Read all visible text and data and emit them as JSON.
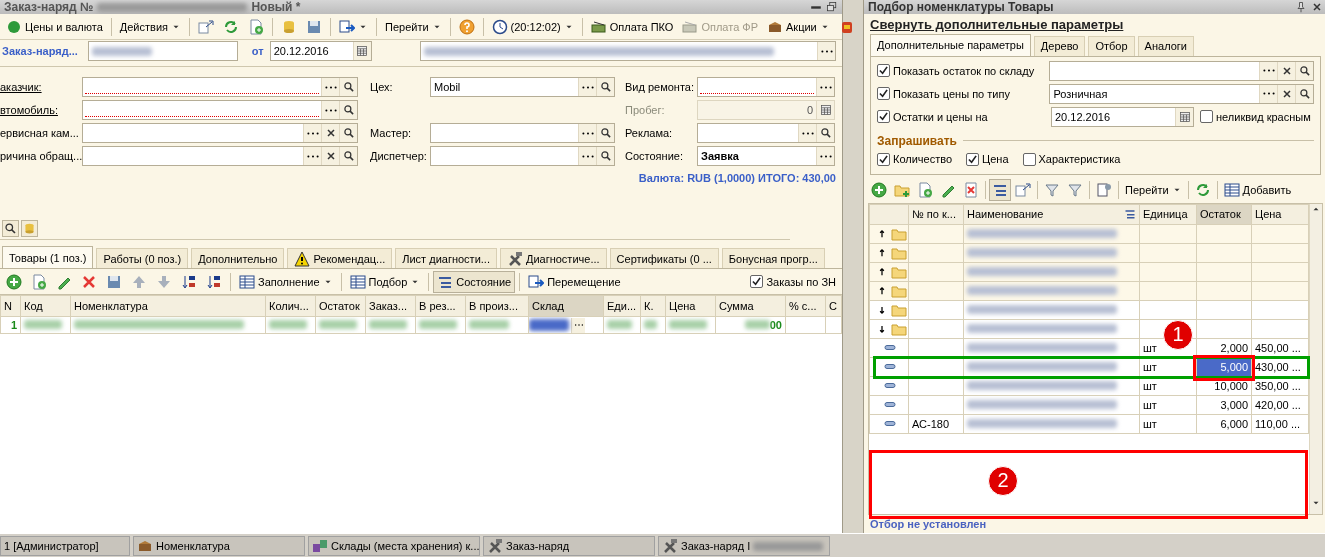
{
  "main_window": {
    "title": "Заказ-наряд №",
    "title_status": "Новый *",
    "toolbar": [
      {
        "label": "Цены и валюта",
        "disabled": false
      },
      {
        "label": "Действия",
        "disabled": false
      },
      {
        "label": "Перейти",
        "disabled": false
      },
      {
        "label": "(20:12:02)",
        "disabled": false
      },
      {
        "label": "Оплата ПКО",
        "disabled": false
      },
      {
        "label": "Оплата ФР",
        "disabled": true
      },
      {
        "label": "Акции",
        "disabled": false
      }
    ],
    "header": {
      "doc_link": "Заказ-наряд...",
      "date_label": "от",
      "date": "20.12.2016"
    },
    "field_rows": [
      [
        {
          "kind": "ref",
          "label": "аказчик:",
          "link": true,
          "required": true,
          "clearable": false,
          "searchable": true
        },
        {
          "kind": "ref",
          "label": "Цех:",
          "value": "Mobil",
          "link": false,
          "required": false,
          "clearable": false,
          "searchable": true
        },
        {
          "kind": "ref",
          "label": "Вид ремонта:",
          "link": false,
          "required": true,
          "clearable": false,
          "searchable": false
        }
      ],
      [
        {
          "kind": "ref",
          "label": "втомобиль:",
          "link": true,
          "required": true,
          "clearable": false,
          "searchable": true
        },
        null,
        {
          "kind": "number",
          "label": "Пробег:",
          "value": "0",
          "disabled": true
        }
      ],
      [
        {
          "kind": "ref",
          "label": "ервисная кам...",
          "link": false,
          "required": false,
          "clearable": true,
          "searchable": true
        },
        {
          "kind": "ref",
          "label": "Мастер:",
          "link": false,
          "required": false,
          "clearable": false,
          "searchable": true
        },
        {
          "kind": "ref",
          "label": "Реклама:",
          "link": false,
          "required": false,
          "clearable": false,
          "searchable": true
        }
      ],
      [
        {
          "kind": "ref",
          "label": "ричина обращ...",
          "link": false,
          "required": false,
          "clearable": true,
          "searchable": true
        },
        {
          "kind": "ref",
          "label": "Диспетчер:",
          "link": false,
          "required": false,
          "clearable": false,
          "searchable": true
        },
        {
          "kind": "ref",
          "label": "Состояние:",
          "value": "Заявка",
          "link": false,
          "required": false,
          "clearable": false,
          "searchable": false
        }
      ]
    ],
    "total": "Валюта: RUB (1,0000) ИТОГО: 430,00",
    "tabs": [
      {
        "label": "Товары (1 поз.)",
        "selected": true
      },
      {
        "label": "Работы (0 поз.)",
        "selected": false
      },
      {
        "label": "Дополнительно",
        "selected": false
      },
      {
        "label": "Рекомендац...",
        "selected": false
      },
      {
        "label": "Лист диагности...",
        "selected": false
      },
      {
        "label": "Диагностиче...",
        "selected": false
      },
      {
        "label": "Сертификаты (0 ...",
        "selected": false
      },
      {
        "label": "Бонусная прогр...",
        "selected": false
      }
    ],
    "table_toolbar": {
      "buttons": [
        {
          "label": "Заполнение",
          "pressed": false
        },
        {
          "label": "Подбор",
          "pressed": false
        },
        {
          "label": "Состояние",
          "pressed": true
        },
        {
          "label": "Перемещение",
          "pressed": false
        }
      ],
      "checkbox": {
        "label": "Заказы по ЗН",
        "checked": true
      }
    },
    "table": {
      "columns": [
        "N",
        "Код",
        "Номенклатура",
        "Колич...",
        "Остаток",
        "Заказ...",
        "В рез...",
        "В произ...",
        "Склад",
        "Еди...",
        "К.",
        "Цена",
        "Сумма",
        "% с...",
        "С"
      ],
      "rows": [
        {
          "number": "1",
          "sum": "00"
        }
      ]
    }
  },
  "picker": {
    "title": "Подбор номенклатуры Товары",
    "collapse_link": "Свернуть дополнительные параметры",
    "tabs": [
      {
        "label": "Дополнительные параметры",
        "selected": true
      },
      {
        "label": "Дерево",
        "selected": false
      },
      {
        "label": "Отбор",
        "selected": false
      },
      {
        "label": "Аналоги",
        "selected": false
      }
    ],
    "options": [
      {
        "kind": "ref",
        "label": "Показать остаток по складу",
        "checked": true
      },
      {
        "kind": "ref",
        "label": "Показать цены по типу",
        "checked": true,
        "value": "Розничная"
      },
      {
        "kind": "date",
        "label": "Остатки и цены на",
        "checked": true,
        "value": "20.12.2016",
        "extra": {
          "label": "неликвид красным",
          "checked": false
        }
      }
    ],
    "ask_group": {
      "title": "Запрашивать",
      "items": [
        {
          "label": "Количество",
          "checked": true
        },
        {
          "label": "Цена",
          "checked": true
        },
        {
          "label": "Характеристика",
          "checked": false
        }
      ]
    },
    "toolbar": [
      "Перейти",
      "Добавить"
    ],
    "table": {
      "columns": [
        "№ по к...",
        "Наименование",
        "Единица",
        "Остаток",
        "Цена"
      ],
      "rows": [
        {
          "kind": "group",
          "expanded": true
        },
        {
          "kind": "group",
          "expanded": true
        },
        {
          "kind": "group",
          "expanded": true
        },
        {
          "kind": "group",
          "expanded": true
        },
        {
          "kind": "group",
          "expanded": false
        },
        {
          "kind": "group",
          "expanded": false
        },
        {
          "kind": "item",
          "unit": "шт",
          "stock": "2,000",
          "price": "450,00 ...",
          "selected": false
        },
        {
          "kind": "item",
          "unit": "шт",
          "stock": "5,000",
          "price": "430,00 ...",
          "selected": true
        },
        {
          "kind": "item",
          "unit": "шт",
          "stock": "10,000",
          "price": "350,00 ...",
          "selected": false
        },
        {
          "kind": "item",
          "unit": "шт",
          "stock": "3,000",
          "price": "420,00 ...",
          "selected": false
        },
        {
          "kind": "item",
          "code": "АС-180",
          "unit": "шт",
          "stock": "6,000",
          "price": "110,00 ...",
          "selected": false
        }
      ]
    },
    "annotations": [
      {
        "kind": "frame",
        "color": "#00a000"
      },
      {
        "kind": "frame",
        "color": "#ff0000"
      },
      {
        "kind": "frame",
        "color": "#ff0000"
      },
      {
        "kind": "badge",
        "label": "1"
      },
      {
        "kind": "badge",
        "label": "2"
      }
    ],
    "footer": "Отбор не установлен"
  },
  "taskbar": [
    {
      "label": "1 [Администратор]"
    },
    {
      "label": "Номенклатура"
    },
    {
      "label": "Склады (места хранения) к..."
    },
    {
      "label": "Заказ-наряд"
    },
    {
      "label": "Заказ-наряд I"
    }
  ]
}
